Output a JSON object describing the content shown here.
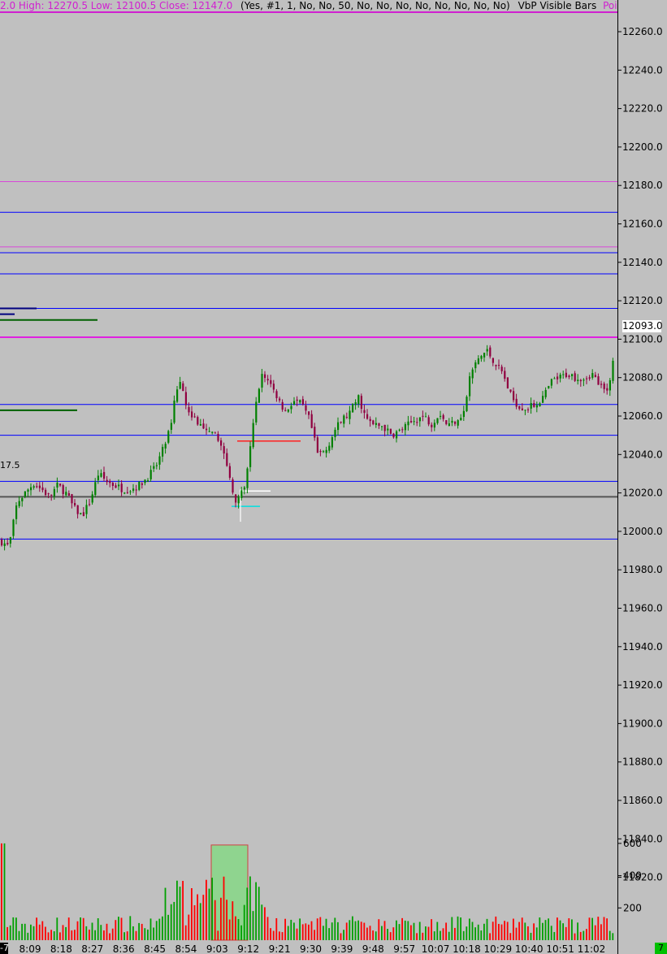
{
  "header": {
    "ohlc": "2.0  High: 12270.5  Low: 12100.5  Close: 12147.0",
    "params": "(Yes, #1, 1, No, No, 50, No, No, No, No, No, No, No, No)",
    "study": "VbP Visible Bars",
    "study2": "Point"
  },
  "current_price_label": "12093.0",
  "side_value_label": "17.5",
  "left_badge": "-7",
  "right_badge": "7",
  "colors": {
    "background": "#c0c0c0",
    "up_candle": "#008000",
    "down_candle": "#900040",
    "up_volume": "#00a000",
    "down_volume": "#ff0000",
    "blue_level": "#0000ff",
    "magenta_level": "#e020e0"
  },
  "chart_data": [
    {
      "type": "candlestick",
      "x_tick_labels": [
        "8:09",
        "8:18",
        "8:27",
        "8:36",
        "8:45",
        "8:54",
        "9:03",
        "9:12",
        "9:21",
        "9:30",
        "9:39",
        "9:48",
        "9:57",
        "10:07",
        "10:18",
        "10:29",
        "10:40",
        "10:51",
        "11:02"
      ],
      "y_ticks": [
        11820,
        11840,
        11860,
        11880,
        11900,
        11920,
        11940,
        11960,
        11980,
        12000,
        12020,
        12040,
        12060,
        12080,
        12100,
        12120,
        12140,
        12160,
        12180,
        12200,
        12220,
        12240,
        12260
      ],
      "y_tick_labels": [
        "11820.0",
        "11840.0",
        "11860.0",
        "11880.0",
        "11900.0",
        "11920.0",
        "11940.0",
        "11960.0",
        "11980.0",
        "12000.0",
        "12020.0",
        "12040.0",
        "12060.0",
        "12080.0",
        "12100.0",
        "12120.0",
        "12140.0",
        "12160.0",
        "12180.0",
        "12200.0",
        "12220.0",
        "12240.0",
        "12260.0"
      ],
      "ylim": [
        11818,
        12270
      ],
      "last_price": 12093.0,
      "blue_levels": [
        12166,
        12145,
        12134,
        12116,
        12066,
        12050,
        12026,
        11996
      ],
      "magenta_levels": [
        12101
      ],
      "thin_magenta_levels": [
        12182,
        12148
      ],
      "gray_level": 12018,
      "close_path": [
        [
          0,
          11995
        ],
        [
          10,
          11992
        ],
        [
          20,
          12015
        ],
        [
          30,
          12020
        ],
        [
          40,
          12025
        ],
        [
          50,
          12022
        ],
        [
          60,
          12018
        ],
        [
          70,
          12024
        ],
        [
          80,
          12020
        ],
        [
          90,
          12012
        ],
        [
          100,
          12008
        ],
        [
          110,
          12016
        ],
        [
          120,
          12030
        ],
        [
          130,
          12026
        ],
        [
          140,
          12024
        ],
        [
          150,
          12022
        ],
        [
          160,
          12022
        ],
        [
          170,
          12024
        ],
        [
          180,
          12028
        ],
        [
          190,
          12033
        ],
        [
          200,
          12043
        ],
        [
          210,
          12055
        ],
        [
          215,
          12072
        ],
        [
          222,
          12080
        ],
        [
          230,
          12062
        ],
        [
          240,
          12058
        ],
        [
          250,
          12052
        ],
        [
          260,
          12050
        ],
        [
          270,
          12048
        ],
        [
          280,
          12030
        ],
        [
          290,
          12015
        ],
        [
          300,
          12022
        ],
        [
          305,
          12038
        ],
        [
          312,
          12060
        ],
        [
          320,
          12082
        ],
        [
          330,
          12078
        ],
        [
          340,
          12070
        ],
        [
          350,
          12062
        ],
        [
          360,
          12068
        ],
        [
          370,
          12066
        ],
        [
          380,
          12058
        ],
        [
          390,
          12040
        ],
        [
          400,
          12042
        ],
        [
          410,
          12052
        ],
        [
          420,
          12058
        ],
        [
          430,
          12062
        ],
        [
          440,
          12070
        ],
        [
          450,
          12058
        ],
        [
          460,
          12055
        ],
        [
          470,
          12055
        ],
        [
          480,
          12050
        ],
        [
          490,
          12052
        ],
        [
          500,
          12055
        ],
        [
          510,
          12058
        ],
        [
          520,
          12060
        ],
        [
          530,
          12056
        ],
        [
          540,
          12062
        ],
        [
          550,
          12055
        ],
        [
          560,
          12058
        ],
        [
          570,
          12062
        ],
        [
          578,
          12082
        ],
        [
          588,
          12090
        ],
        [
          598,
          12094
        ],
        [
          608,
          12088
        ],
        [
          618,
          12082
        ],
        [
          628,
          12070
        ],
        [
          638,
          12065
        ],
        [
          648,
          12064
        ],
        [
          658,
          12066
        ],
        [
          668,
          12070
        ],
        [
          678,
          12078
        ],
        [
          688,
          12080
        ],
        [
          698,
          12082
        ],
        [
          708,
          12080
        ],
        [
          718,
          12080
        ],
        [
          728,
          12082
        ],
        [
          738,
          12075
        ],
        [
          746,
          12072
        ],
        [
          752,
          12085
        ],
        [
          756,
          12093
        ]
      ],
      "volume_y_ticks": [
        200,
        400,
        600
      ],
      "volume_y_tick_labels": [
        "200",
        "400",
        "600"
      ],
      "volume_ylim": [
        0,
        680
      ],
      "volume_highlight_x_range": [
        260,
        305
      ]
    }
  ]
}
